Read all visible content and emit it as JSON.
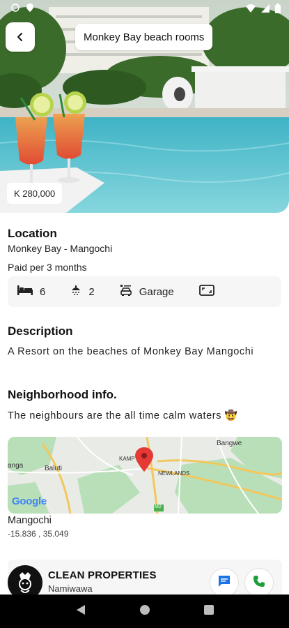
{
  "header": {
    "title": "Monkey Bay beach rooms",
    "back_icon": "chevron-left-icon"
  },
  "hero": {
    "price": "K 280,000"
  },
  "location": {
    "heading": "Location",
    "address": "Monkey Bay - Mangochi",
    "payment": "Paid per 3 months"
  },
  "features": [
    {
      "icon": "bed-icon",
      "value": "6"
    },
    {
      "icon": "shower-icon",
      "value": "2"
    },
    {
      "icon": "garage-icon",
      "value": "Garage"
    },
    {
      "icon": "area-icon",
      "value": ""
    }
  ],
  "description": {
    "heading": "Description",
    "text": "A Resort on the beaches of Monkey Bay Mangochi"
  },
  "neighborhood": {
    "heading": "Neighborhood info.",
    "text": "The neighbours are the all time calm waters 🤠"
  },
  "map": {
    "labels": [
      "Bangwe",
      "anga",
      "Baluti",
      "KAMP",
      "NEWLANDS",
      "M2"
    ],
    "logo": "Google",
    "place": "Mangochi",
    "coords": "-15.836 , 35.049"
  },
  "agent": {
    "name": "CLEAN PROPERTIES",
    "location": "Namiwawa"
  },
  "colors": {
    "message_blue": "#1a73e8",
    "phone_green": "#1e9e3a",
    "map_pin": "#e53935"
  }
}
